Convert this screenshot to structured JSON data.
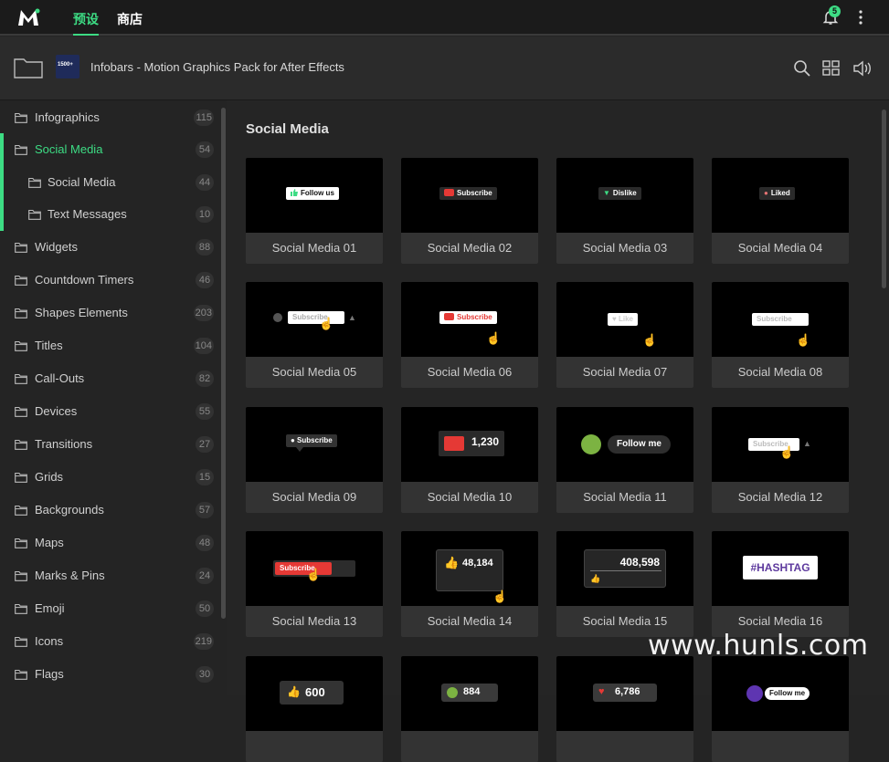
{
  "topbar": {
    "tabs": [
      "预设",
      "商店"
    ],
    "notification_count": "5"
  },
  "pack": {
    "thumb_text": "1500+",
    "title": "Infobars - Motion Graphics Pack for After Effects"
  },
  "sidebar": {
    "items": [
      {
        "label": "Infographics",
        "count": "115"
      },
      {
        "label": "Social Media",
        "count": "54"
      },
      {
        "label": "Social Media",
        "count": "44"
      },
      {
        "label": "Text Messages",
        "count": "10"
      },
      {
        "label": "Widgets",
        "count": "88"
      },
      {
        "label": "Countdown Timers",
        "count": "46"
      },
      {
        "label": "Shapes Elements",
        "count": "203"
      },
      {
        "label": "Titles",
        "count": "104"
      },
      {
        "label": "Call-Outs",
        "count": "82"
      },
      {
        "label": "Devices",
        "count": "55"
      },
      {
        "label": "Transitions",
        "count": "27"
      },
      {
        "label": "Grids",
        "count": "15"
      },
      {
        "label": "Backgrounds",
        "count": "57"
      },
      {
        "label": "Maps",
        "count": "48"
      },
      {
        "label": "Marks & Pins",
        "count": "24"
      },
      {
        "label": "Emoji",
        "count": "50"
      },
      {
        "label": "Icons",
        "count": "219"
      },
      {
        "label": "Flags",
        "count": "30"
      }
    ]
  },
  "main": {
    "section_title": "Social Media",
    "cards": [
      {
        "name": "Social Media 01",
        "preview": "Follow us"
      },
      {
        "name": "Social Media 02",
        "preview": "Subscribe"
      },
      {
        "name": "Social Media 03",
        "preview": "Dislike"
      },
      {
        "name": "Social Media 04",
        "preview": "Liked"
      },
      {
        "name": "Social Media 05",
        "preview": "Subscribe"
      },
      {
        "name": "Social Media 06",
        "preview": "Subscribe"
      },
      {
        "name": "Social Media 07",
        "preview": "Like"
      },
      {
        "name": "Social Media 08",
        "preview": "Subscribe"
      },
      {
        "name": "Social Media 09",
        "preview": "Subscribe"
      },
      {
        "name": "Social Media 10",
        "preview": "1,230"
      },
      {
        "name": "Social Media 11",
        "preview": "Follow me"
      },
      {
        "name": "Social Media 12",
        "preview": "Subscribe"
      },
      {
        "name": "Social Media 13",
        "preview": "Subscribe"
      },
      {
        "name": "Social Media 14",
        "preview": "48,184"
      },
      {
        "name": "Social Media 15",
        "preview": "408,598"
      },
      {
        "name": "Social Media 16",
        "preview": "#HASHTAG"
      },
      {
        "name": "",
        "preview": "600"
      },
      {
        "name": "",
        "preview": "884"
      },
      {
        "name": "",
        "preview": "6,786"
      },
      {
        "name": "",
        "preview": "Follow me"
      }
    ]
  },
  "watermark": "www.hunls.com",
  "colors": {
    "accent": "#3ddc84",
    "background": "#242424",
    "youtube_red": "#e53935"
  }
}
